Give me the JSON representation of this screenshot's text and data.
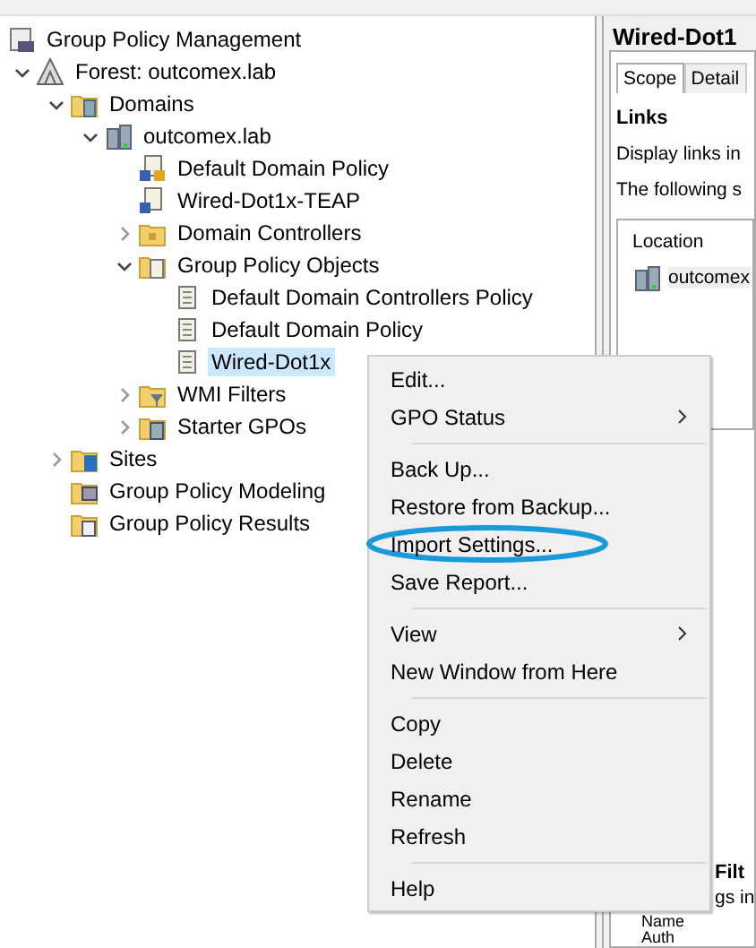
{
  "tree": [
    {
      "label": "Group Policy Management",
      "kind": "console",
      "selected": false,
      "children": [
        {
          "label": "Forest: outcomex.lab",
          "kind": "forest",
          "expanded": true,
          "selected": false,
          "children": [
            {
              "label": "Domains",
              "kind": "domains",
              "expanded": true,
              "selected": false,
              "children": [
                {
                  "label": "outcomex.lab",
                  "kind": "domain",
                  "expanded": true,
                  "selected": false,
                  "children": [
                    {
                      "label": "Default Domain Policy",
                      "kind": "linklocked",
                      "selected": false
                    },
                    {
                      "label": "Wired-Dot1x-TEAP",
                      "kind": "link",
                      "selected": false
                    },
                    {
                      "label": "Domain Controllers",
                      "kind": "ou",
                      "expanded": false,
                      "selected": false
                    },
                    {
                      "label": "Group Policy Objects",
                      "kind": "gpofolder",
                      "expanded": true,
                      "selected": false,
                      "children": [
                        {
                          "label": "Default Domain Controllers Policy",
                          "kind": "gpo",
                          "selected": false
                        },
                        {
                          "label": "Default Domain Policy",
                          "kind": "gpo",
                          "selected": false
                        },
                        {
                          "label": "Wired-Dot1x",
                          "kind": "gpo",
                          "selected": true
                        }
                      ]
                    },
                    {
                      "label": "WMI Filters",
                      "kind": "wmi",
                      "expanded": false,
                      "selected": false
                    },
                    {
                      "label": "Starter GPOs",
                      "kind": "starter",
                      "expanded": false,
                      "selected": false
                    }
                  ]
                }
              ]
            },
            {
              "label": "Sites",
              "kind": "sites",
              "expanded": false,
              "selected": false
            },
            {
              "label": "Group Policy Modeling",
              "kind": "modeling",
              "selected": false
            },
            {
              "label": "Group Policy Results",
              "kind": "results",
              "selected": false
            }
          ]
        }
      ]
    }
  ],
  "details": {
    "title": "Wired-Dot1",
    "tabs": [
      {
        "label": "Scope",
        "selected": true
      },
      {
        "label": "Detail",
        "selected": false
      }
    ],
    "section": "Links",
    "description": "Display links in",
    "note": "The following s",
    "links_table": {
      "column": "Location",
      "rows": [
        "outcomex"
      ]
    },
    "filter_section": "Filt",
    "filter_text": "gs in",
    "filter_column": "Name",
    "filter_rows": [
      "Auth"
    ]
  },
  "context_menu": [
    {
      "kind": "item",
      "label": "Edit...",
      "submenu": false,
      "highlighted": false
    },
    {
      "kind": "item",
      "label": "GPO Status",
      "submenu": true,
      "highlighted": false
    },
    {
      "kind": "separator"
    },
    {
      "kind": "item",
      "label": "Back Up...",
      "submenu": false,
      "highlighted": false
    },
    {
      "kind": "item",
      "label": "Restore from Backup...",
      "submenu": false,
      "highlighted": false
    },
    {
      "kind": "item",
      "label": "Import Settings...",
      "submenu": false,
      "highlighted": true
    },
    {
      "kind": "item",
      "label": "Save Report...",
      "submenu": false,
      "highlighted": false
    },
    {
      "kind": "separator"
    },
    {
      "kind": "item",
      "label": "View",
      "submenu": true,
      "highlighted": false
    },
    {
      "kind": "item",
      "label": "New Window from Here",
      "submenu": false,
      "highlighted": false
    },
    {
      "kind": "separator"
    },
    {
      "kind": "item",
      "label": "Copy",
      "submenu": false,
      "highlighted": false
    },
    {
      "kind": "item",
      "label": "Delete",
      "submenu": false,
      "highlighted": false
    },
    {
      "kind": "item",
      "label": "Rename",
      "submenu": false,
      "highlighted": false
    },
    {
      "kind": "item",
      "label": "Refresh",
      "submenu": false,
      "highlighted": false
    },
    {
      "kind": "separator"
    },
    {
      "kind": "item",
      "label": "Help",
      "submenu": false,
      "highlighted": false
    }
  ]
}
